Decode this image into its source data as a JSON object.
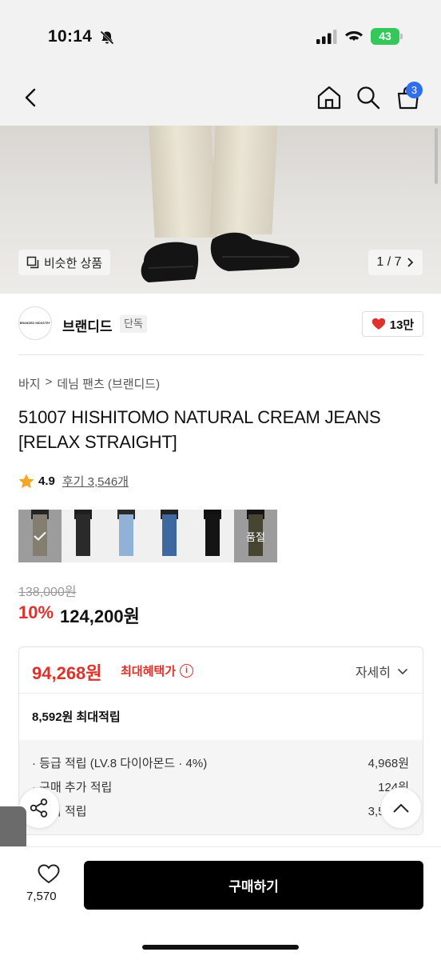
{
  "status_bar": {
    "time": "10:14",
    "battery": "43"
  },
  "header": {
    "cart_count": "3"
  },
  "hero": {
    "similar_label": "비슷한 상품",
    "page_indicator": "1 / 7"
  },
  "brand": {
    "logo_text": "BRANDED INDUSTRY",
    "name": "브랜디드",
    "tag": "단독",
    "likes": "13만"
  },
  "breadcrumb": [
    "바지",
    ">",
    "데님 팬츠 (브랜디드)"
  ],
  "product": {
    "title": "51007 HISHITOMO NATURAL CREAM JEANS [RELAX STRAIGHT]",
    "rating": "4.9",
    "reviews": "후기 3,546개"
  },
  "swatches": [
    {
      "name": "natural-cream",
      "pants": "#c9c2ad",
      "top": "#3a3a3a",
      "selected": true
    },
    {
      "name": "black-wash",
      "pants": "#2a2a2a",
      "top": "#1f1f1f"
    },
    {
      "name": "light-blue",
      "pants": "#8fb2d6",
      "top": "#2b2b2b"
    },
    {
      "name": "mid-blue",
      "pants": "#3f68a0",
      "top": "#222222"
    },
    {
      "name": "black",
      "pants": "#141414",
      "top": "#111111"
    },
    {
      "name": "olive",
      "pants": "#6d6a4c",
      "top": "#222222",
      "soldout_label": "품절"
    }
  ],
  "price": {
    "original": "138,000원",
    "discount": "10%",
    "sale": "124,200원"
  },
  "benefit": {
    "max_price": "94,268원",
    "max_label": "최대혜택가",
    "info_icon": "i",
    "detail_label": "자세히",
    "points_title": "8,592원 최대적립",
    "rows": [
      {
        "label": "· 등급 적립 (LV.8 다이아몬드 · 4%)",
        "value": "4,968원"
      },
      {
        "label": "· 구매 추가 적립",
        "value": "124원"
      },
      {
        "label": "· 후기 적립",
        "value": "3,500원"
      }
    ]
  },
  "bottom": {
    "wish_count": "7,570",
    "buy_label": "구매하기"
  },
  "colors": {
    "accent_red": "#e0312b",
    "badge_blue": "#2f6fed",
    "battery_green": "#34c759"
  },
  "icons": [
    "bell-off-icon",
    "signal-icon",
    "wifi-icon",
    "battery-icon",
    "back-icon",
    "home-icon",
    "search-icon",
    "cart-icon",
    "similar-icon",
    "chevron-right-icon",
    "heart-icon",
    "star-icon",
    "check-icon",
    "info-icon",
    "chevron-down-icon",
    "share-icon",
    "chevron-up-icon",
    "handle-chevron-icon",
    "heart-outline-icon"
  ]
}
